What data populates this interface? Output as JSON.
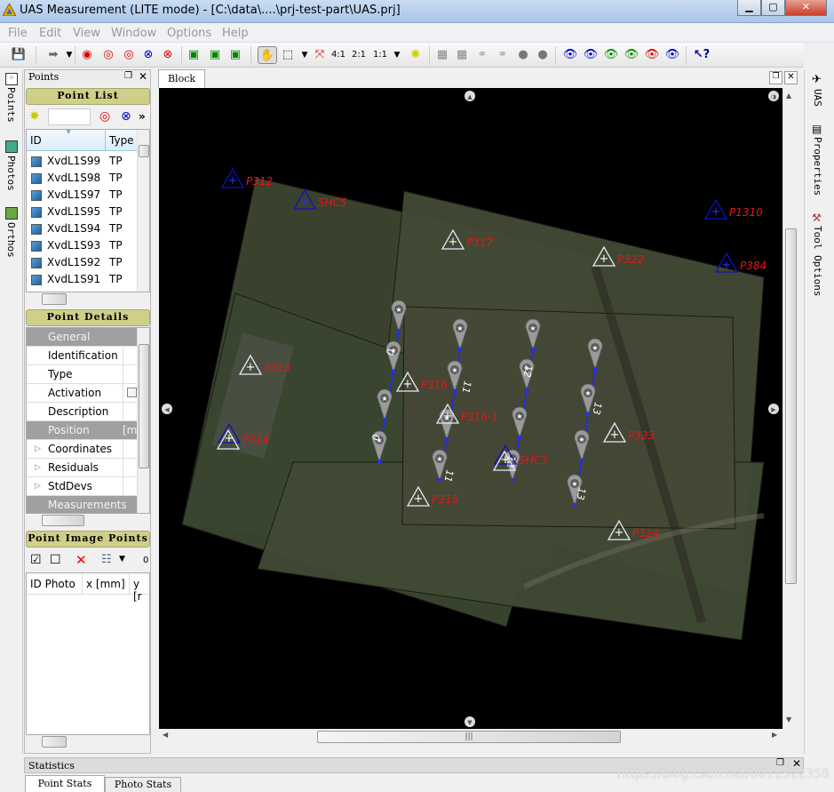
{
  "window": {
    "title": "UAS Measurement (LITE mode) - [C:\\data\\....\\prj-test-part\\UAS.prj]",
    "buttons": [
      "minimize",
      "maximize",
      "close"
    ]
  },
  "menu": [
    "File",
    "Edit",
    "View",
    "Window",
    "Options",
    "Help"
  ],
  "toolbar": {
    "zoom_ratios": [
      "4:1",
      "2:1",
      "1:1"
    ],
    "help": "?"
  },
  "left_tabs": [
    "Points",
    "Photos",
    "Orthos"
  ],
  "points_panel": {
    "title": "Points",
    "point_list_header": "Point List",
    "search_value": "",
    "columns": [
      "ID",
      "Type"
    ],
    "rows": [
      {
        "id": "XvdL1S99",
        "type": "TP"
      },
      {
        "id": "XvdL1S98",
        "type": "TP"
      },
      {
        "id": "XvdL1S97",
        "type": "TP"
      },
      {
        "id": "XvdL1S95",
        "type": "TP"
      },
      {
        "id": "XvdL1S94",
        "type": "TP"
      },
      {
        "id": "XvdL1S93",
        "type": "TP"
      },
      {
        "id": "XvdL1S92",
        "type": "TP"
      },
      {
        "id": "XvdL1S91",
        "type": "TP"
      }
    ],
    "more": "»"
  },
  "point_details": {
    "header": "Point Details",
    "rows": [
      {
        "label": "General",
        "group": true
      },
      {
        "label": "Identification"
      },
      {
        "label": "Type"
      },
      {
        "label": "Activation",
        "checkbox": true
      },
      {
        "label": "Description"
      },
      {
        "label": "Position",
        "group": true,
        "value": "[m"
      },
      {
        "label": "Coordinates",
        "expand": true
      },
      {
        "label": "Residuals",
        "expand": true
      },
      {
        "label": "StdDevs",
        "expand": true
      },
      {
        "label": "Measurements",
        "group": true
      }
    ]
  },
  "point_image_points": {
    "header": "Point Image Points",
    "count": "0",
    "columns": [
      "ID Photo",
      "x [mm]",
      "y [r"
    ]
  },
  "block": {
    "tab": "Block",
    "points": [
      {
        "label": "P312",
        "kind": "control"
      },
      {
        "label": "SHC5",
        "kind": "control"
      },
      {
        "label": "P317",
        "kind": "check"
      },
      {
        "label": "P322",
        "kind": "check"
      },
      {
        "label": "P1310",
        "kind": "control"
      },
      {
        "label": "P384",
        "kind": "control"
      },
      {
        "label": "P313",
        "kind": "check"
      },
      {
        "label": "P316",
        "kind": "check"
      },
      {
        "label": "P316-1",
        "kind": "check"
      },
      {
        "label": "P314",
        "kind": "both"
      },
      {
        "label": "SHC3",
        "kind": "both"
      },
      {
        "label": "P323",
        "kind": "check"
      },
      {
        "label": "P315",
        "kind": "check"
      },
      {
        "label": "P324",
        "kind": "check"
      }
    ],
    "strips": [
      {
        "label": "0"
      },
      {
        "label": "11"
      },
      {
        "label": "12"
      },
      {
        "label": "13"
      }
    ]
  },
  "right_tabs": [
    "UAS",
    "Properties",
    "Tool Options"
  ],
  "statistics": {
    "title": "Statistics",
    "tabs": [
      "Point Stats",
      "Photo Stats"
    ],
    "active_tab": "Point Stats"
  },
  "watermark": "https://blog.csdn.net/u011322358",
  "colors": {
    "control": "#1010c0",
    "check": "#e8e8f8",
    "label": "#e8141a",
    "strip_line": "#1a2aff",
    "panel_header": "#cfcf8a"
  }
}
